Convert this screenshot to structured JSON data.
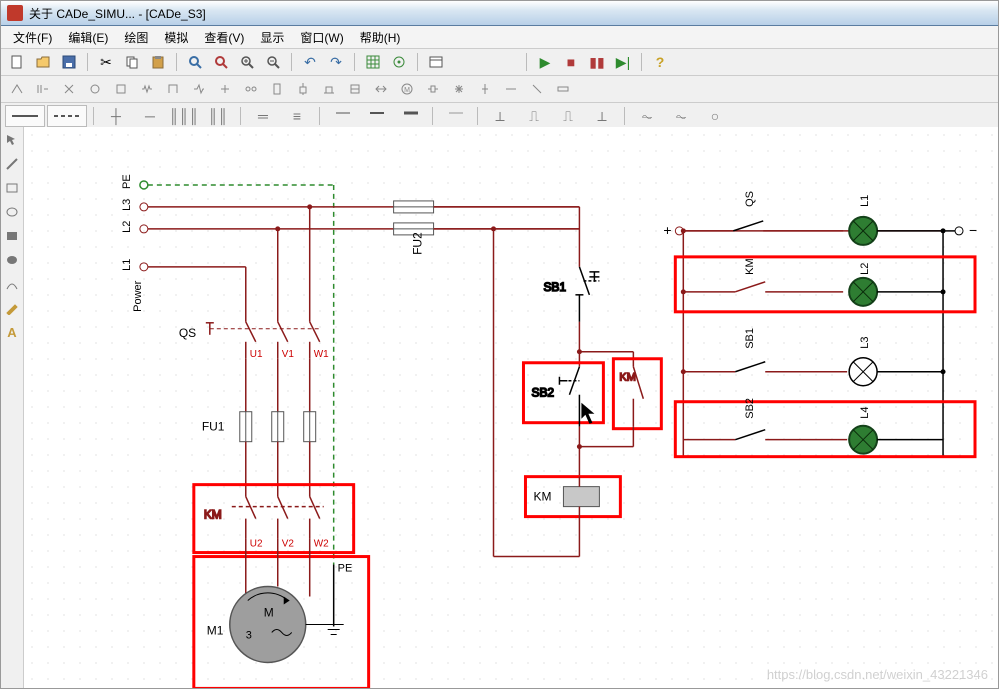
{
  "window": {
    "title": "关于 CADe_SIMU... - [CADe_S3]"
  },
  "menu": [
    "文件(F)",
    "编辑(E)",
    "绘图",
    "模拟",
    "查看(V)",
    "显示",
    "窗口(W)",
    "帮助(H)"
  ],
  "toolbar1_icons": [
    "new",
    "open",
    "save",
    "sep",
    "cut",
    "copy",
    "paste",
    "sep",
    "search1",
    "search2",
    "zoom-in",
    "zoom-out",
    "sep",
    "undo",
    "redo",
    "sep",
    "grid",
    "snap",
    "sep",
    "panel"
  ],
  "toolbar_sim": [
    "play",
    "step",
    "stop",
    "pause",
    "next",
    "sep",
    "help"
  ],
  "toolbar3_glyphs": [
    "—",
    "—",
    "—",
    "┃",
    "─",
    "┼",
    "║║║",
    "║║",
    "═",
    "≡",
    "—",
    "—",
    "—",
    "─",
    "⏚",
    "⟂",
    "⎍",
    "⎍",
    "⋮",
    "⏦",
    "⏦",
    "⟂"
  ],
  "side_icons": [
    "arrow",
    "line",
    "rect",
    "ellipse",
    "fill-rect",
    "triangle",
    "curve",
    "pen",
    "text"
  ],
  "labels": {
    "PE_top": "PE",
    "L3": "L3",
    "L2": "L2",
    "L1": "L1",
    "Power": "Power",
    "QS": "QS",
    "U1": "U1",
    "V1": "V1",
    "W1": "W1",
    "FU1": "FU1",
    "FU2": "FU2",
    "KM": "KM",
    "U2": "U2",
    "V2": "V2",
    "W2": "W2",
    "PE": "PE",
    "M1": "M1",
    "M": "M",
    "three": "3",
    "SB1": "SB1",
    "SB2": "SB2",
    "right_QS": "QS",
    "right_KM": "KM",
    "right_SB1": "SB1",
    "right_SB2": "SB2",
    "lamp_L1": "L1",
    "lamp_L2": "L2",
    "lamp_L3": "L3",
    "lamp_L4": "L4",
    "minus": "−",
    "plus": "+"
  },
  "colors": {
    "wire": "#8b1a1a",
    "pe": "#2e8b2e",
    "black": "#000",
    "highlight": "#ff0000",
    "lamp": "#2e7d32",
    "motor": "#9e9e9e"
  },
  "watermark": "https://blog.csdn.net/weixin_43221346"
}
